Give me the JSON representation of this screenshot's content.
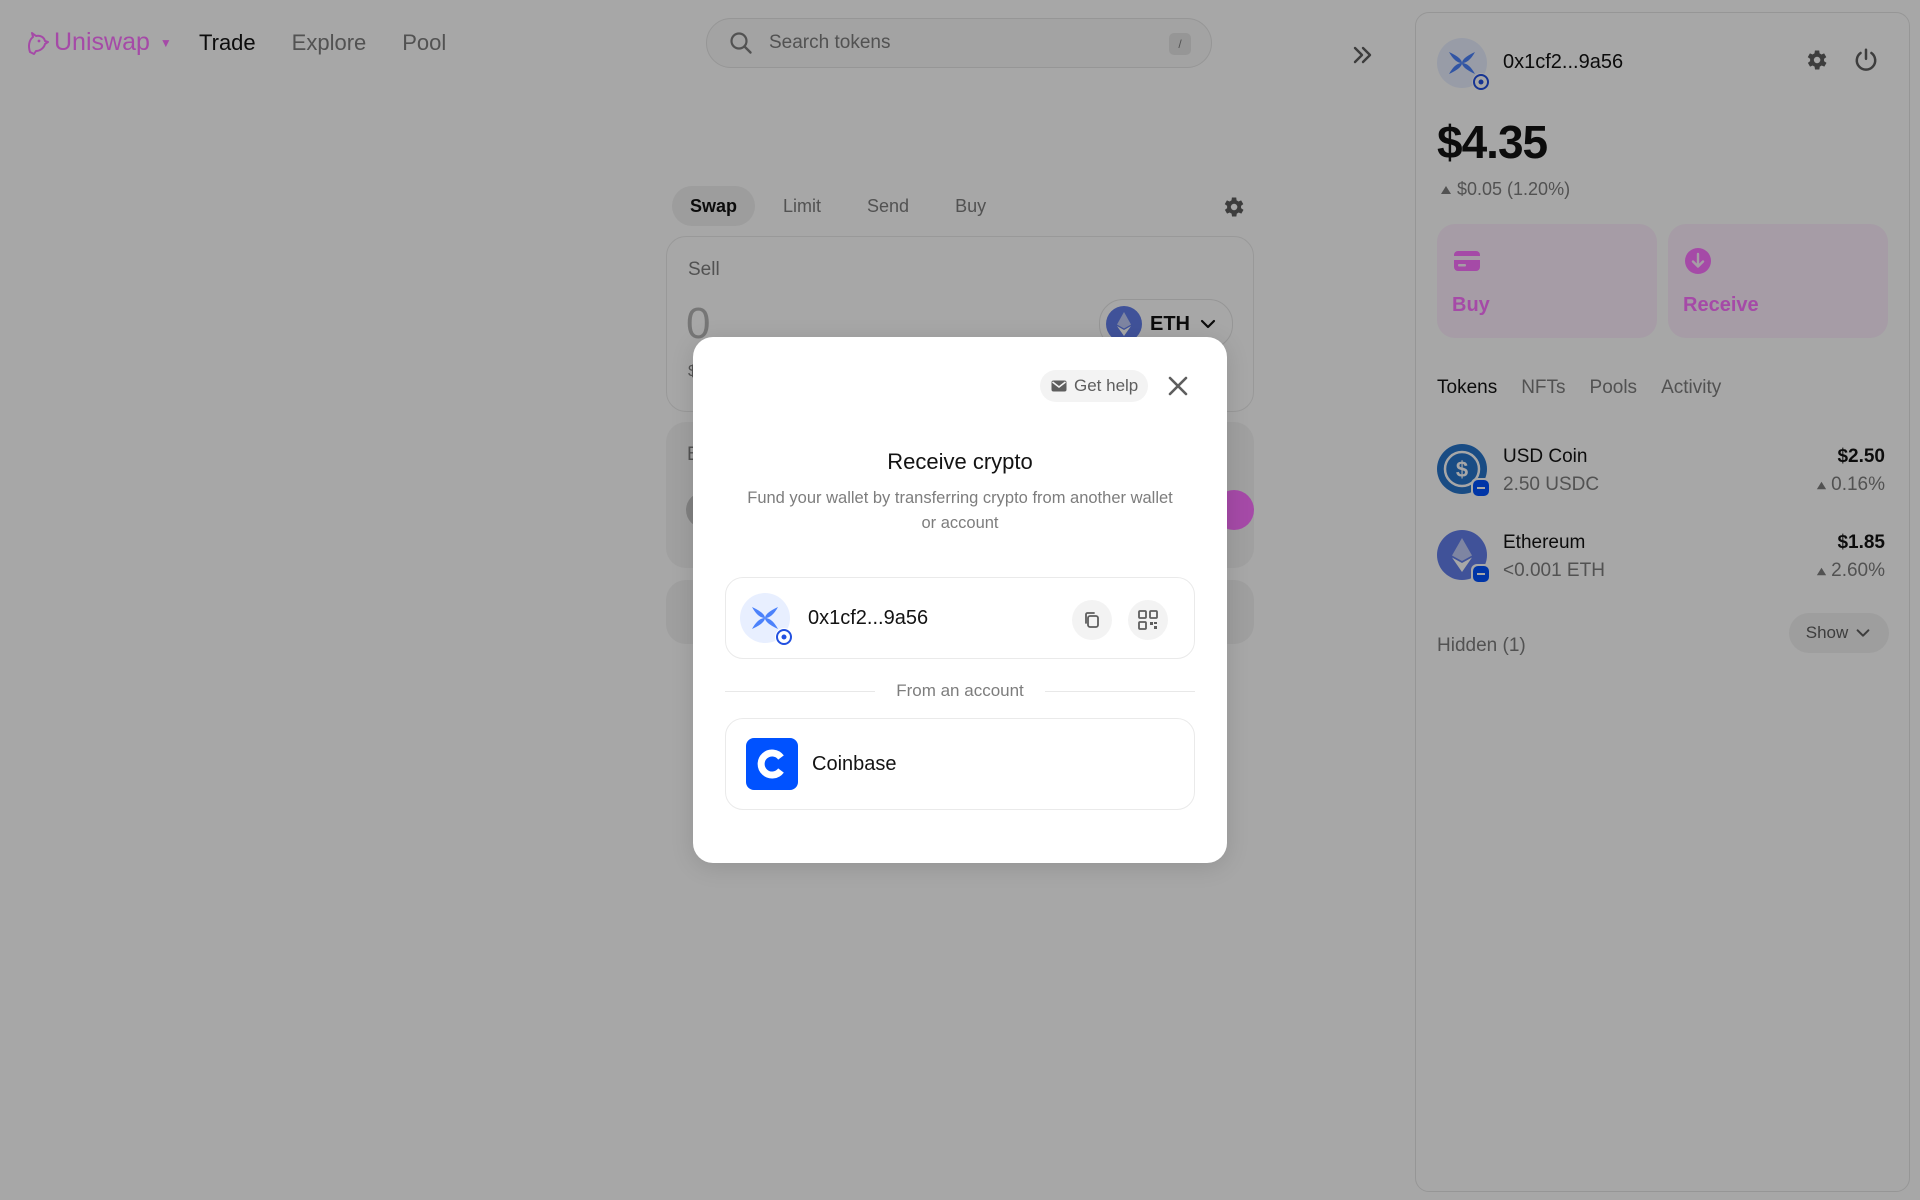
{
  "nav": {
    "logo_text": "Uniswap",
    "links": [
      "Trade",
      "Explore",
      "Pool"
    ],
    "active_link": "Trade",
    "search_placeholder": "Search tokens",
    "search_shortcut": "/"
  },
  "swap": {
    "tabs": [
      "Swap",
      "Limit",
      "Send",
      "Buy"
    ],
    "active_tab": "Swap",
    "sell_label": "Sell",
    "sell_amount": "0",
    "sell_usd_partial": "$",
    "sell_token": "ETH",
    "buy_label_partial": "B"
  },
  "wallet": {
    "address": "0x1cf2...9a56",
    "balance": "$4.35",
    "change": "$0.05 (1.20%)",
    "actions": [
      "Buy",
      "Receive"
    ],
    "tabs": [
      "Tokens",
      "NFTs",
      "Pools",
      "Activity"
    ],
    "active_tab": "Tokens",
    "tokens": [
      {
        "name": "USD Coin",
        "amount": "2.50 USDC",
        "value": "$2.50",
        "change": "0.16%"
      },
      {
        "name": "Ethereum",
        "amount": "<0.001 ETH",
        "value": "$1.85",
        "change": "2.60%"
      }
    ],
    "hidden_label": "Hidden (1)",
    "show_label": "Show"
  },
  "modal": {
    "get_help": "Get help",
    "title": "Receive crypto",
    "subtitle": "Fund your wallet by transferring crypto from another wallet or account",
    "address": "0x1cf2...9a56",
    "divider": "From an account",
    "account_name": "Coinbase"
  },
  "colors": {
    "accent_pink": "#fc72ff",
    "avatar_blue": "#4c82fb",
    "coinbase_blue": "#0052ff",
    "usdc_blue": "#2775ca",
    "eth_indigo": "#627eea"
  }
}
